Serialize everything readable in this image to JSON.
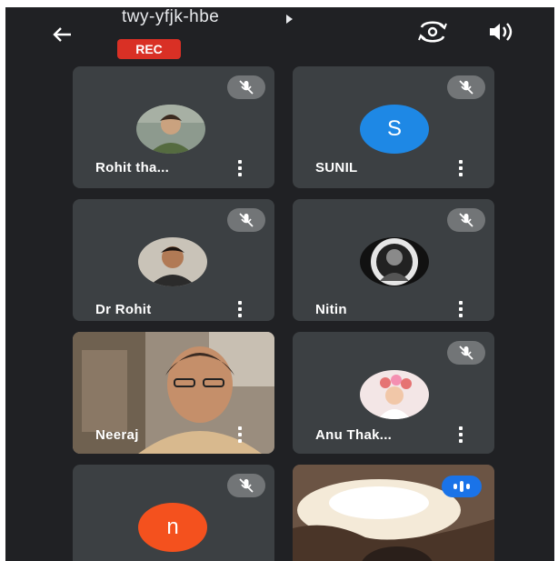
{
  "header": {
    "meeting_code": "twy-yfjk-hbe",
    "rec_label": "REC",
    "back_icon": "arrow-left-icon",
    "switch_camera_icon": "switch-camera-icon",
    "speaker_icon": "speaker-icon"
  },
  "participants": [
    {
      "name": "Rohit tha...",
      "type": "photo",
      "muted": true
    },
    {
      "name": "SUNIL",
      "type": "letter",
      "initial": "S",
      "color": "#1e88e5",
      "muted": true
    },
    {
      "name": "Dr Rohit",
      "type": "photo",
      "muted": true
    },
    {
      "name": "Nitin",
      "type": "photo",
      "muted": true
    },
    {
      "name": "Neeraj",
      "type": "video",
      "muted": false
    },
    {
      "name": "Anu Thak...",
      "type": "photo",
      "muted": true
    },
    {
      "name": "",
      "type": "letter",
      "initial": "n",
      "color": "#f4511e",
      "muted": true
    },
    {
      "name": "",
      "type": "video",
      "speaking": true
    }
  ],
  "colors": {
    "background": "#202124",
    "tile": "#3c4043",
    "rec": "#d93025",
    "speaking": "#1a73e8"
  }
}
